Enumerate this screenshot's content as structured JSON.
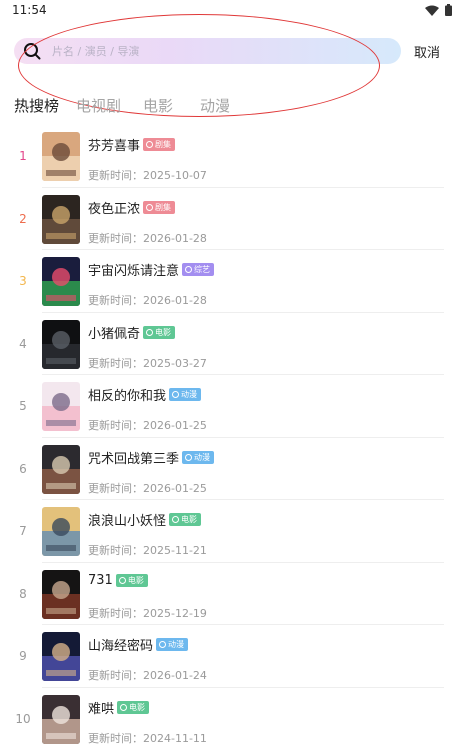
{
  "status_bar": {
    "time": "11:54",
    "icons": [
      "wifi-icon",
      "battery-icon"
    ]
  },
  "search": {
    "placeholder": "片名 / 演员 / 导演",
    "value": "",
    "cancel_label": "取消"
  },
  "tabs": [
    {
      "label": "热搜榜",
      "active": true
    },
    {
      "label": "电视剧",
      "active": false
    },
    {
      "label": "电影",
      "active": false
    },
    {
      "label": "动漫",
      "active": false
    }
  ],
  "update_prefix": "更新时间：",
  "category_colors": {
    "剧集": "#ee8b95",
    "综艺": "#a38ef0",
    "电影": "#5fc794",
    "动漫": "#6db8ee"
  },
  "rank_colors": [
    "#e3468a",
    "#ee6d4e",
    "#f3b64c",
    "#9a9a9a"
  ],
  "items": [
    {
      "rank": "1",
      "title": "芬芳喜事",
      "category": "剧集",
      "updated": "2025-10-07"
    },
    {
      "rank": "2",
      "title": "夜色正浓",
      "category": "剧集",
      "updated": "2026-01-28"
    },
    {
      "rank": "3",
      "title": "宇宙闪烁请注意",
      "category": "综艺",
      "updated": "2026-01-28"
    },
    {
      "rank": "4",
      "title": "小猪佩奇",
      "category": "电影",
      "updated": "2025-03-27"
    },
    {
      "rank": "5",
      "title": "相反的你和我",
      "category": "动漫",
      "updated": "2026-01-25"
    },
    {
      "rank": "6",
      "title": "咒术回战第三季",
      "category": "动漫",
      "updated": "2026-01-25"
    },
    {
      "rank": "7",
      "title": "浪浪山小妖怪",
      "category": "电影",
      "updated": "2025-11-21"
    },
    {
      "rank": "8",
      "title": "731",
      "category": "电影",
      "updated": "2025-12-19"
    },
    {
      "rank": "9",
      "title": "山海经密码",
      "category": "动漫",
      "updated": "2026-01-24"
    },
    {
      "rank": "10",
      "title": "难哄",
      "category": "电影",
      "updated": "2024-11-11"
    }
  ]
}
